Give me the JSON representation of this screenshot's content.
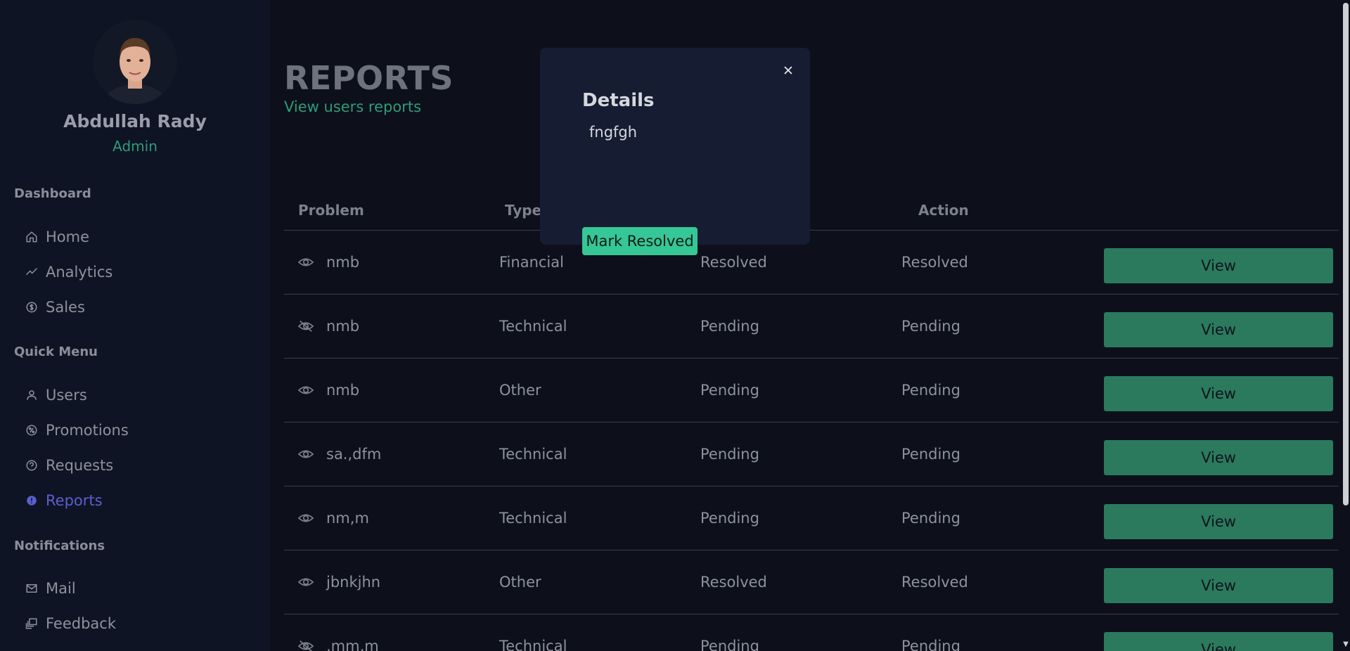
{
  "sidebar": {
    "user": {
      "name": "Abdullah Rady",
      "role": "Admin"
    },
    "sections": [
      {
        "title": "Dashboard",
        "items": [
          {
            "label": "Home",
            "icon": "home-icon"
          },
          {
            "label": "Analytics",
            "icon": "trend-icon"
          },
          {
            "label": "Sales",
            "icon": "dollar-circle-icon"
          }
        ]
      },
      {
        "title": "Quick Menu",
        "items": [
          {
            "label": "Users",
            "icon": "user-icon"
          },
          {
            "label": "Promotions",
            "icon": "promotion-icon"
          },
          {
            "label": "Requests",
            "icon": "request-icon"
          },
          {
            "label": "Reports",
            "icon": "alert-circle-icon",
            "active": true
          }
        ]
      },
      {
        "title": "Notifications",
        "items": [
          {
            "label": "Mail",
            "icon": "mail-icon"
          },
          {
            "label": "Feedback",
            "icon": "feedback-icon"
          }
        ]
      }
    ]
  },
  "header": {
    "title": "REPORTS",
    "subtitle": "View users reports"
  },
  "table": {
    "columns": [
      "Problem",
      "Type",
      "Action"
    ],
    "view_label": "View",
    "rows": [
      {
        "problem": "nmb",
        "type": "Financial",
        "status": "Resolved",
        "action": "Resolved",
        "seen": true
      },
      {
        "problem": "nmb",
        "type": "Technical",
        "status": "Pending",
        "action": "Pending",
        "seen": false
      },
      {
        "problem": "nmb",
        "type": "Other",
        "status": "Pending",
        "action": "Pending",
        "seen": true
      },
      {
        "problem": "sa.,dfm",
        "type": "Technical",
        "status": "Pending",
        "action": "Pending",
        "seen": true
      },
      {
        "problem": "nm,m",
        "type": "Technical",
        "status": "Pending",
        "action": "Pending",
        "seen": true
      },
      {
        "problem": "jbnkjhn",
        "type": "Other",
        "status": "Resolved",
        "action": "Resolved",
        "seen": true
      },
      {
        "problem": ",mm,m",
        "type": "Technical",
        "status": "Pending",
        "action": "Pending",
        "seen": false
      }
    ]
  },
  "modal": {
    "title": "Details",
    "body": "fngfgh",
    "resolve_label": "Mark Resolved"
  },
  "colors": {
    "accent": "#2f9b78",
    "active_nav": "#5a5fd0",
    "button": "#2b7a5e",
    "resolve_button": "#35c795"
  }
}
